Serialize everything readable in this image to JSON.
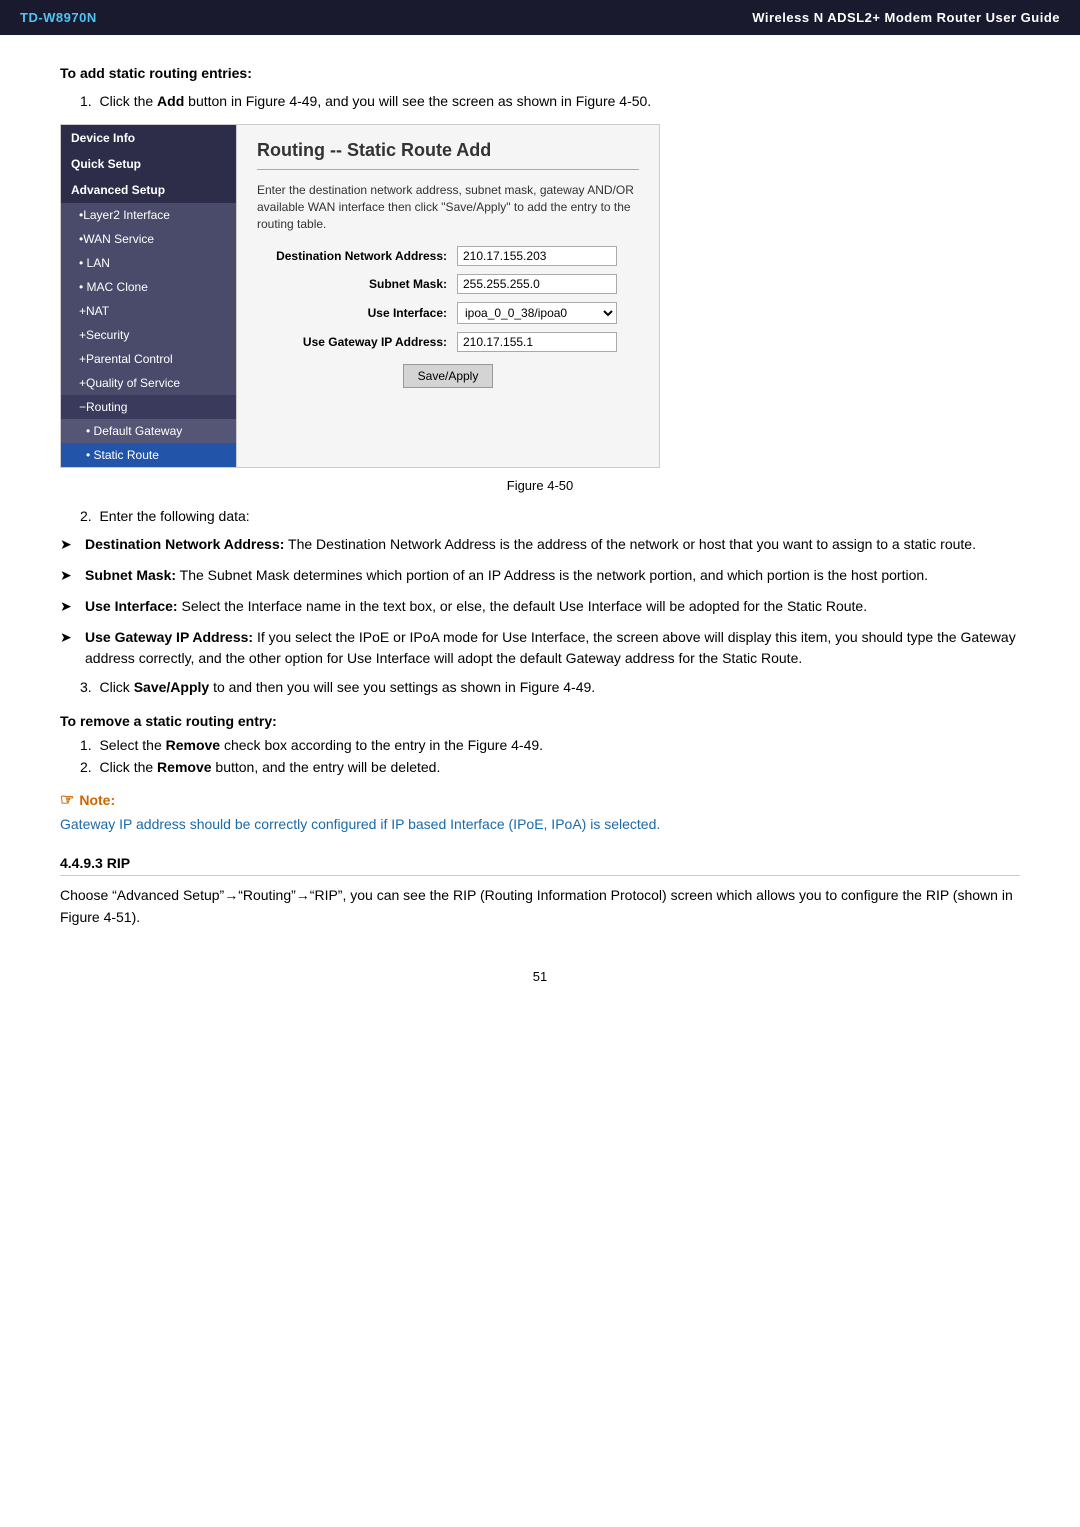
{
  "header": {
    "model": "TD-W8970N",
    "title": "Wireless  N  ADSL2+  Modem  Router  User  Guide"
  },
  "sidebar": {
    "items": [
      {
        "label": "Device Info",
        "type": "header",
        "active": false
      },
      {
        "label": "Quick Setup",
        "type": "header",
        "active": false
      },
      {
        "label": "Advanced Setup",
        "type": "header",
        "active": false
      },
      {
        "label": "•Layer2 Interface",
        "type": "sub",
        "active": false
      },
      {
        "label": "•WAN Service",
        "type": "sub",
        "active": false
      },
      {
        "label": "• LAN",
        "type": "sub",
        "active": false
      },
      {
        "label": "• MAC Clone",
        "type": "sub",
        "active": false
      },
      {
        "label": "+NAT",
        "type": "sub",
        "active": false
      },
      {
        "label": "+Security",
        "type": "sub",
        "active": false
      },
      {
        "label": "+Parental Control",
        "type": "sub",
        "active": false
      },
      {
        "label": "+Quality of Service",
        "type": "sub",
        "active": false
      },
      {
        "label": "−Routing",
        "type": "sub-minus",
        "active": false
      },
      {
        "label": "• Default Gateway",
        "type": "sub2",
        "active": false
      },
      {
        "label": "• Static Route",
        "type": "sub2",
        "active": true
      }
    ]
  },
  "panel": {
    "title": "Routing -- Static Route Add",
    "description": "Enter the destination network address, subnet mask, gateway AND/OR available WAN interface then click \"Save/Apply\" to add the entry to the routing table.",
    "fields": {
      "destination_label": "Destination Network Address:",
      "destination_value": "210.17.155.203",
      "subnet_label": "Subnet Mask:",
      "subnet_value": "255.255.255.0",
      "interface_label": "Use Interface:",
      "interface_value": "ipoa_0_0_38/ipoa0",
      "gateway_label": "Use Gateway IP Address:",
      "gateway_value": "210.17.155.1"
    },
    "save_button": "Save/Apply"
  },
  "figure_caption": "Figure 4-50",
  "content": {
    "heading1": "To add static routing entries:",
    "step1": "Click the Add button in Figure 4-49, and you will see the screen as shown in Figure 4-50.",
    "step2": "Enter the following data:",
    "bullets": [
      {
        "bold_intro": "Destination Network Address:",
        "text": " The Destination Network Address is the address of the network or host that you want to assign to a static route."
      },
      {
        "bold_intro": "Subnet Mask:",
        "text": " The Subnet Mask determines which portion of an IP Address is the network portion, and which portion is the host portion."
      },
      {
        "bold_intro": "Use Interface:",
        "text": " Select the Interface name in the text box, or else, the default Use Interface will be adopted for the Static Route."
      },
      {
        "bold_intro": "Use Gateway IP Address:",
        "text": "  If you select the IPoE or IPoA mode for Use Interface, the screen above will display this item, you should type the Gateway address correctly, and the other option for Use Interface will adopt the default Gateway address for the Static Route."
      }
    ],
    "step3": "Click Save/Apply to and then you will see you settings as shown in Figure 4-49.",
    "heading2": "To remove a static routing entry:",
    "remove_step1": "Select the Remove check box according to the entry in the Figure 4-49.",
    "remove_step2": "Click the Remove button, and the entry will be deleted.",
    "note_label": "Note:",
    "note_text": "Gateway IP address should be correctly configured if IP based Interface (IPoE, IPoA) is selected.",
    "section_443_title": "4.4.9.3  RIP",
    "section_443_text": "Choose “Advanced Setup”→“Routing”→“RIP”, you can see the RIP (Routing Information Protocol) screen which allows you to configure the RIP (shown in Figure 4-51)."
  },
  "page_number": "51"
}
